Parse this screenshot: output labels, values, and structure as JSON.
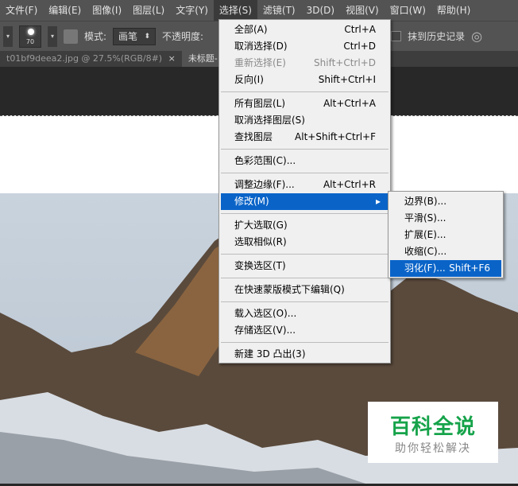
{
  "menubar": [
    "文件(F)",
    "编辑(E)",
    "图像(I)",
    "图层(L)",
    "文字(Y)",
    "选择(S)",
    "滤镜(T)",
    "3D(D)",
    "视图(V)",
    "窗口(W)",
    "帮助(H)"
  ],
  "options": {
    "brush_size": "70",
    "mode_label": "模式:",
    "mode_value": "画笔",
    "opacity_label": "不透明度:",
    "history_label": "抹到历史记录"
  },
  "tabs": [
    "t01bf9deea2.jpg @ 27.5%(RGB/8#)",
    "×",
    "未标题-"
  ],
  "select_menu": [
    {
      "label": "全部(A)",
      "shortcut": "Ctrl+A"
    },
    {
      "label": "取消选择(D)",
      "shortcut": "Ctrl+D"
    },
    {
      "label": "重新选择(E)",
      "shortcut": "Shift+Ctrl+D",
      "disabled": true
    },
    {
      "label": "反向(I)",
      "shortcut": "Shift+Ctrl+I"
    },
    {
      "sep": true
    },
    {
      "label": "所有图层(L)",
      "shortcut": "Alt+Ctrl+A"
    },
    {
      "label": "取消选择图层(S)",
      "shortcut": ""
    },
    {
      "label": "查找图层",
      "shortcut": "Alt+Shift+Ctrl+F"
    },
    {
      "sep": true
    },
    {
      "label": "色彩范围(C)...",
      "shortcut": ""
    },
    {
      "sep": true
    },
    {
      "label": "调整边缘(F)...",
      "shortcut": "Alt+Ctrl+R"
    },
    {
      "label": "修改(M)",
      "shortcut": "▸",
      "highlighted": true
    },
    {
      "sep": true
    },
    {
      "label": "扩大选取(G)",
      "shortcut": ""
    },
    {
      "label": "选取相似(R)",
      "shortcut": ""
    },
    {
      "sep": true
    },
    {
      "label": "变换选区(T)",
      "shortcut": ""
    },
    {
      "sep": true
    },
    {
      "label": "在快速蒙版模式下编辑(Q)",
      "shortcut": ""
    },
    {
      "sep": true
    },
    {
      "label": "载入选区(O)...",
      "shortcut": ""
    },
    {
      "label": "存储选区(V)...",
      "shortcut": ""
    },
    {
      "sep": true
    },
    {
      "label": "新建 3D 凸出(3)",
      "shortcut": ""
    }
  ],
  "modify_submenu": [
    {
      "label": "边界(B)...",
      "shortcut": ""
    },
    {
      "label": "平滑(S)...",
      "shortcut": ""
    },
    {
      "label": "扩展(E)...",
      "shortcut": ""
    },
    {
      "label": "收缩(C)...",
      "shortcut": ""
    },
    {
      "label": "羽化(F)...",
      "shortcut": "Shift+F6",
      "highlighted": true
    }
  ],
  "watermark": {
    "title": "百科全说",
    "subtitle": "助你轻松解决"
  },
  "colors": {
    "highlight": "#0a64c8",
    "menu_bg": "#f0f0f0",
    "watermark_green": "#16a34a"
  }
}
